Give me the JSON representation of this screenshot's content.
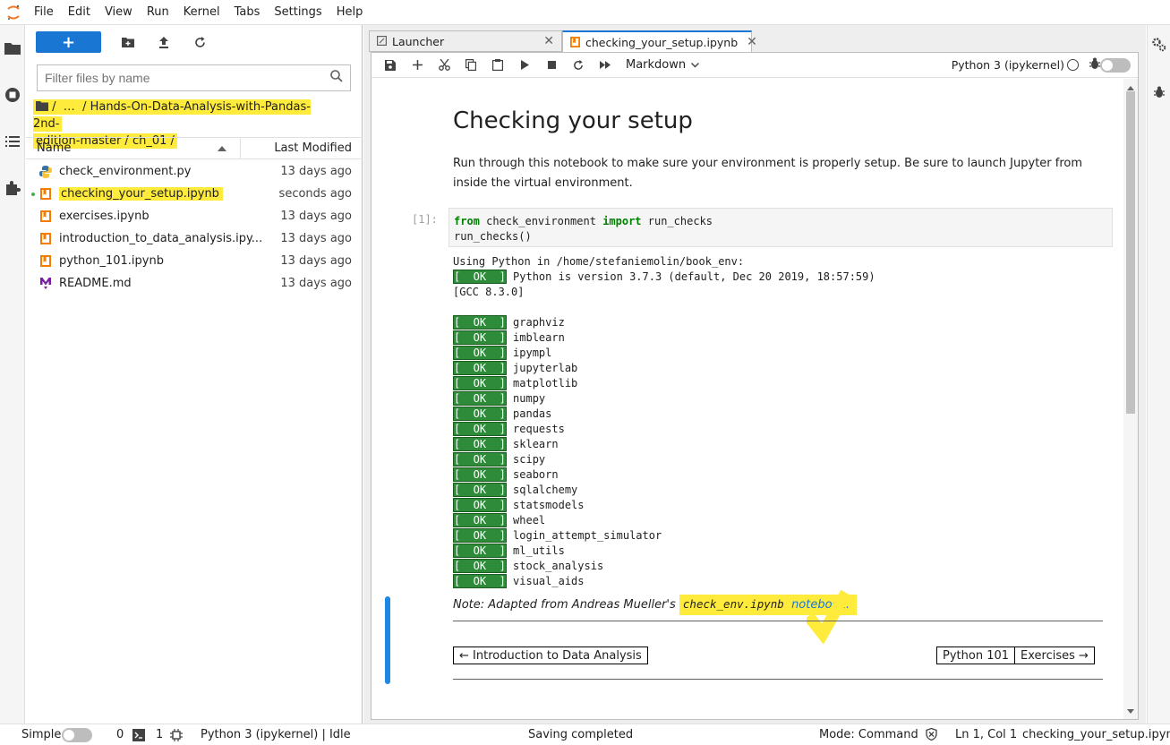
{
  "menubar": {
    "items": [
      "File",
      "Edit",
      "View",
      "Run",
      "Kernel",
      "Tabs",
      "Settings",
      "Help"
    ]
  },
  "filebrowser": {
    "new_label": "+",
    "filter_placeholder": "Filter files by name",
    "breadcrumb": {
      "root": "/",
      "ellipsis": "…",
      "path_line1": "/ Hands-On-Data-Analysis-with-Pandas-2nd-",
      "path_line2": "edition-master / ch_01 /"
    },
    "columns": {
      "name": "Name",
      "modified": "Last Modified"
    },
    "files": [
      {
        "name": "check_environment.py",
        "modified": "13 days ago",
        "icon": "python-icon"
      },
      {
        "name": "checking_your_setup.ipynb",
        "modified": "seconds ago",
        "icon": "notebook-icon"
      },
      {
        "name": "exercises.ipynb",
        "modified": "13 days ago",
        "icon": "notebook-icon"
      },
      {
        "name": "introduction_to_data_analysis.ipy...",
        "modified": "13 days ago",
        "icon": "notebook-icon"
      },
      {
        "name": "python_101.ipynb",
        "modified": "13 days ago",
        "icon": "notebook-icon"
      },
      {
        "name": "README.md",
        "modified": "13 days ago",
        "icon": "markdown-icon"
      }
    ]
  },
  "tabs": [
    {
      "label": "Launcher"
    },
    {
      "label": "checking_your_setup.ipynb"
    }
  ],
  "toolbar": {
    "cell_type": "Markdown",
    "kernel": "Python 3 (ipykernel)"
  },
  "notebook": {
    "title": "Checking your setup",
    "intro": "Run through this notebook to make sure your environment is properly setup. Be sure to launch Jupyter from inside the virtual environment.",
    "prompt": "[1]:",
    "code_kw1": "from",
    "code_mod": " check_environment ",
    "code_kw2": "import",
    "code_fn": " run_checks",
    "code_line2": "run_checks()",
    "output_line1": "Using Python in /home/stefaniemolin/book_env:",
    "ok_label": "[  OK  ]",
    "python_version": " Python is version 3.7.3 (default, Dec 20 2019, 18:57:59)",
    "gcc": "[GCC 8.3.0]",
    "packages": [
      "graphviz",
      "imblearn",
      "ipympl",
      "jupyterlab",
      "matplotlib",
      "numpy",
      "pandas",
      "requests",
      "sklearn",
      "scipy",
      "seaborn",
      "sqlalchemy",
      "statsmodels",
      "wheel",
      "login_attempt_simulator",
      "ml_utils",
      "stock_analysis",
      "visual_aids"
    ],
    "note_prefix": "Note: Adapted from Andreas Mueller's ",
    "note_code": "check_env.ipynb",
    "note_link": "notebook.",
    "nav_prev": "← Introduction to Data Analysis",
    "nav_python": "Python 101",
    "nav_next": "Exercises →"
  },
  "statusbar": {
    "simple": "Simple",
    "terminals": "0",
    "kernels": "1",
    "kernel_status": "Python 3 (ipykernel) | Idle",
    "save_status": "Saving completed",
    "mode": "Mode: Command",
    "position": "Ln 1, Col 1",
    "filename": "checking_your_setup.ipynb"
  },
  "colors": {
    "accent": "#1976d2",
    "highlight": "#ffeb3b",
    "ok_green": "#2e8b3a",
    "notebook_icon": "#f57c00"
  }
}
